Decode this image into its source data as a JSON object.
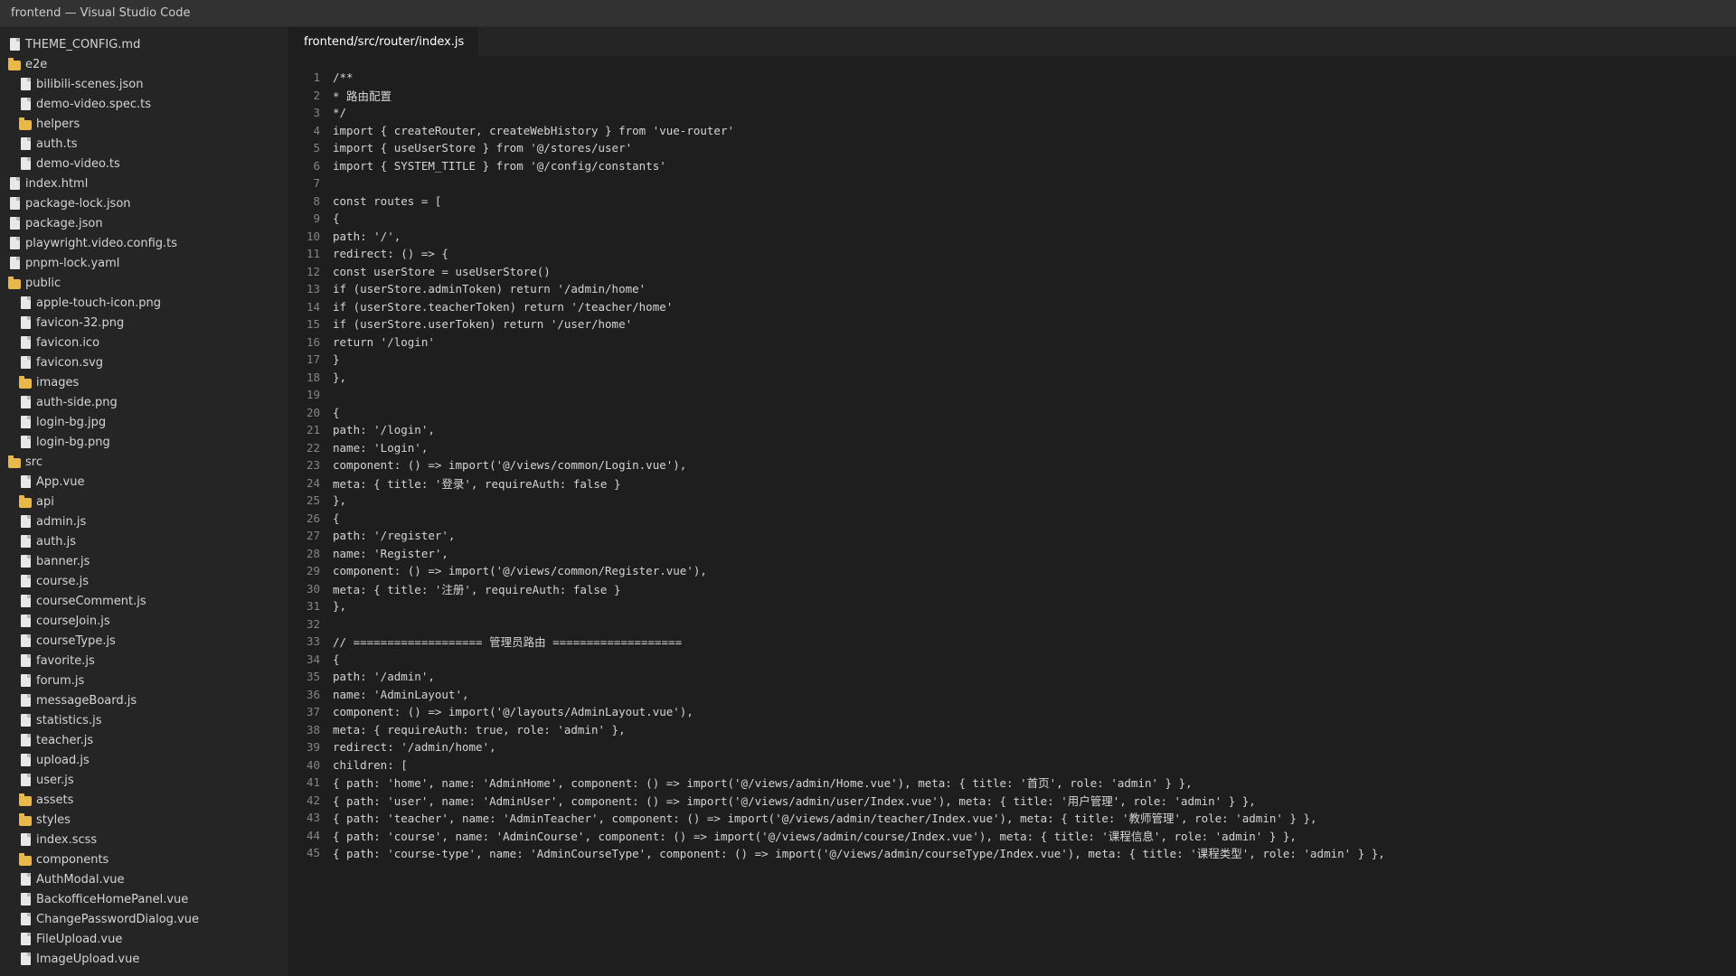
{
  "window": {
    "title": "frontend — Visual Studio Code"
  },
  "explorer": {
    "items": [
      {
        "label": "THEME_CONFIG.md",
        "kind": "file",
        "depth": 0
      },
      {
        "label": "e2e",
        "kind": "folder",
        "depth": 0
      },
      {
        "label": "bilibili-scenes.json",
        "kind": "file",
        "depth": 1
      },
      {
        "label": "demo-video.spec.ts",
        "kind": "file",
        "depth": 1
      },
      {
        "label": "helpers",
        "kind": "folder",
        "depth": 1
      },
      {
        "label": "auth.ts",
        "kind": "file",
        "depth": 1
      },
      {
        "label": "demo-video.ts",
        "kind": "file",
        "depth": 1
      },
      {
        "label": "index.html",
        "kind": "file",
        "depth": 0
      },
      {
        "label": "package-lock.json",
        "kind": "file",
        "depth": 0
      },
      {
        "label": "package.json",
        "kind": "file",
        "depth": 0
      },
      {
        "label": "playwright.video.config.ts",
        "kind": "file",
        "depth": 0
      },
      {
        "label": "pnpm-lock.yaml",
        "kind": "file",
        "depth": 0
      },
      {
        "label": "public",
        "kind": "folder",
        "depth": 0
      },
      {
        "label": "apple-touch-icon.png",
        "kind": "file",
        "depth": 1
      },
      {
        "label": "favicon-32.png",
        "kind": "file",
        "depth": 1
      },
      {
        "label": "favicon.ico",
        "kind": "file",
        "depth": 1
      },
      {
        "label": "favicon.svg",
        "kind": "file",
        "depth": 1
      },
      {
        "label": "images",
        "kind": "folder",
        "depth": 1
      },
      {
        "label": "auth-side.png",
        "kind": "file",
        "depth": 1
      },
      {
        "label": "login-bg.jpg",
        "kind": "file",
        "depth": 1
      },
      {
        "label": "login-bg.png",
        "kind": "file",
        "depth": 1
      },
      {
        "label": "src",
        "kind": "folder",
        "depth": 0
      },
      {
        "label": "App.vue",
        "kind": "file",
        "depth": 1
      },
      {
        "label": "api",
        "kind": "folder",
        "depth": 1
      },
      {
        "label": "admin.js",
        "kind": "file",
        "depth": 1
      },
      {
        "label": "auth.js",
        "kind": "file",
        "depth": 1
      },
      {
        "label": "banner.js",
        "kind": "file",
        "depth": 1
      },
      {
        "label": "course.js",
        "kind": "file",
        "depth": 1
      },
      {
        "label": "courseComment.js",
        "kind": "file",
        "depth": 1
      },
      {
        "label": "courseJoin.js",
        "kind": "file",
        "depth": 1
      },
      {
        "label": "courseType.js",
        "kind": "file",
        "depth": 1
      },
      {
        "label": "favorite.js",
        "kind": "file",
        "depth": 1
      },
      {
        "label": "forum.js",
        "kind": "file",
        "depth": 1
      },
      {
        "label": "messageBoard.js",
        "kind": "file",
        "depth": 1
      },
      {
        "label": "statistics.js",
        "kind": "file",
        "depth": 1
      },
      {
        "label": "teacher.js",
        "kind": "file",
        "depth": 1
      },
      {
        "label": "upload.js",
        "kind": "file",
        "depth": 1
      },
      {
        "label": "user.js",
        "kind": "file",
        "depth": 1
      },
      {
        "label": "assets",
        "kind": "folder",
        "depth": 1
      },
      {
        "label": "styles",
        "kind": "folder",
        "depth": 1
      },
      {
        "label": "index.scss",
        "kind": "file",
        "depth": 1
      },
      {
        "label": "components",
        "kind": "folder",
        "depth": 1
      },
      {
        "label": "AuthModal.vue",
        "kind": "file",
        "depth": 1
      },
      {
        "label": "BackofficeHomePanel.vue",
        "kind": "file",
        "depth": 1
      },
      {
        "label": "ChangePasswordDialog.vue",
        "kind": "file",
        "depth": 1
      },
      {
        "label": "FileUpload.vue",
        "kind": "file",
        "depth": 1
      },
      {
        "label": "ImageUpload.vue",
        "kind": "file",
        "depth": 1
      }
    ]
  },
  "editor": {
    "tab_label": "frontend/src/router/index.js",
    "lines": [
      "/**",
      "* 路由配置",
      "*/",
      "import { createRouter, createWebHistory } from 'vue-router'",
      "import { useUserStore } from '@/stores/user'",
      "import { SYSTEM_TITLE } from '@/config/constants'",
      "",
      "const routes = [",
      "{",
      "path: '/',",
      "redirect: () => {",
      "const userStore = useUserStore()",
      "if (userStore.adminToken) return '/admin/home'",
      "if (userStore.teacherToken) return '/teacher/home'",
      "if (userStore.userToken) return '/user/home'",
      "return '/login'",
      "}",
      "},",
      "",
      "{",
      "path: '/login',",
      "name: 'Login',",
      "component: () => import('@/views/common/Login.vue'),",
      "meta: { title: '登录', requireAuth: false }",
      "},",
      "{",
      "path: '/register',",
      "name: 'Register',",
      "component: () => import('@/views/common/Register.vue'),",
      "meta: { title: '注册', requireAuth: false }",
      "},",
      "",
      "// =================== 管理员路由 ===================",
      "{",
      "path: '/admin',",
      "name: 'AdminLayout',",
      "component: () => import('@/layouts/AdminLayout.vue'),",
      "meta: { requireAuth: true, role: 'admin' },",
      "redirect: '/admin/home',",
      "children: [",
      "{ path: 'home', name: 'AdminHome', component: () => import('@/views/admin/Home.vue'), meta: { title: '首页', role: 'admin' } },",
      "{ path: 'user', name: 'AdminUser', component: () => import('@/views/admin/user/Index.vue'), meta: { title: '用户管理', role: 'admin' } },",
      "{ path: 'teacher', name: 'AdminTeacher', component: () => import('@/views/admin/teacher/Index.vue'), meta: { title: '教师管理', role: 'admin' } },",
      "{ path: 'course', name: 'AdminCourse', component: () => import('@/views/admin/course/Index.vue'), meta: { title: '课程信息', role: 'admin' } },",
      "{ path: 'course-type', name: 'AdminCourseType', component: () => import('@/views/admin/courseType/Index.vue'), meta: { title: '课程类型', role: 'admin' } },"
    ]
  }
}
